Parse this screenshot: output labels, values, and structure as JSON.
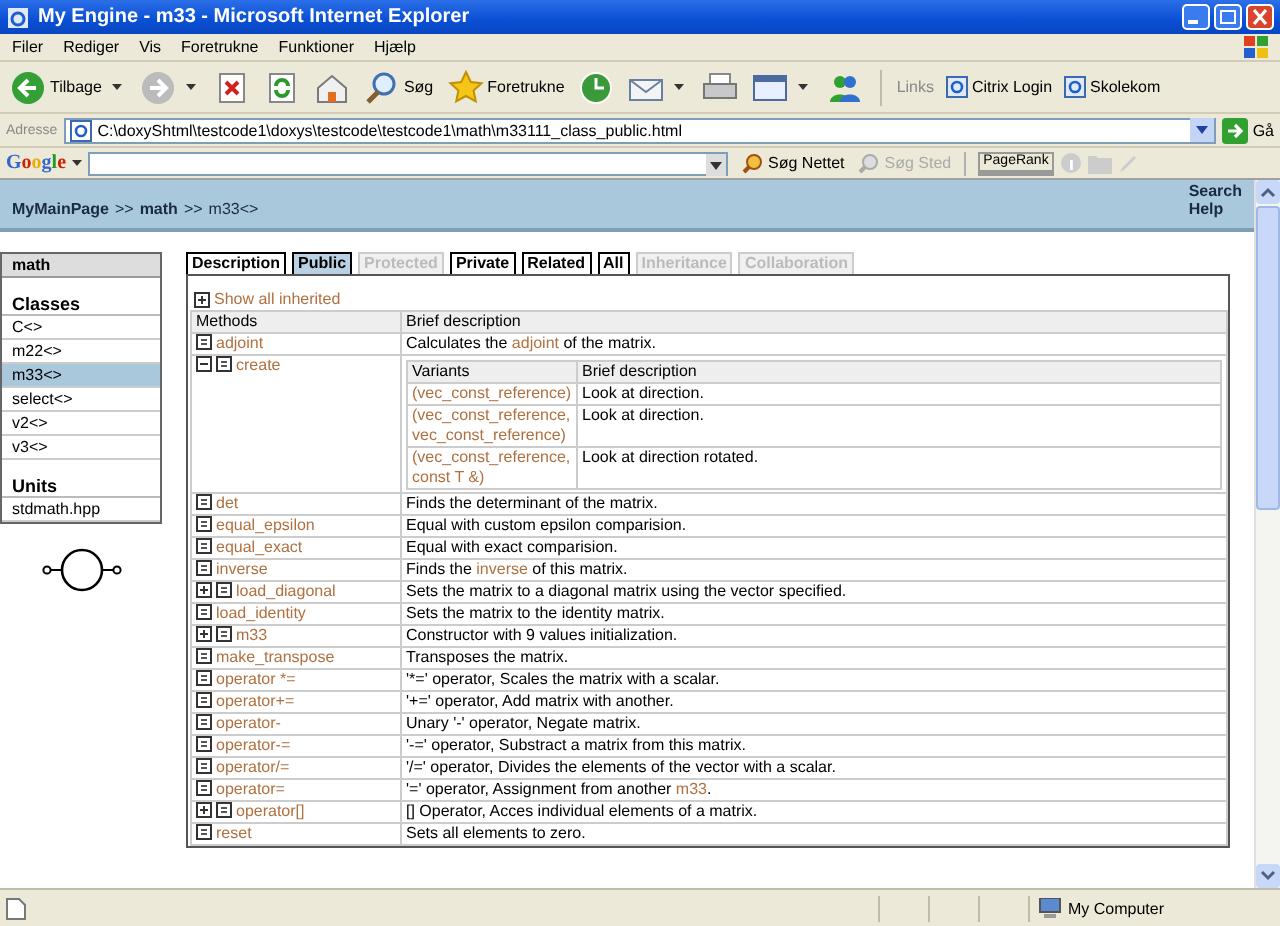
{
  "window": {
    "title": "My Engine - m33 - Microsoft Internet Explorer"
  },
  "menu": [
    "Filer",
    "Rediger",
    "Vis",
    "Foretrukne",
    "Funktioner",
    "Hjælp"
  ],
  "toolbar": [
    {
      "kind": "back",
      "label": "Tilbage",
      "menu": true
    },
    {
      "kind": "forward",
      "menu": true
    },
    {
      "kind": "stop"
    },
    {
      "kind": "refresh"
    },
    {
      "kind": "home"
    },
    {
      "kind": "search",
      "label": "Søg"
    },
    {
      "kind": "favorites",
      "label": "Foretrukne"
    },
    {
      "kind": "history"
    },
    {
      "kind": "mail",
      "menu": true
    },
    {
      "kind": "print"
    },
    {
      "kind": "edit",
      "menu": true
    },
    {
      "kind": "messenger"
    }
  ],
  "links": {
    "label": "Links",
    "items": [
      "Citrix Login",
      "Skolekom"
    ]
  },
  "address": {
    "label": "Adresse",
    "value": "C:\\doxyShtml\\testcode1\\doxys\\testcode\\testcode1\\math\\m33111_class_public.html",
    "go": "Gå"
  },
  "google": {
    "logo": "Google",
    "buttons": [
      {
        "label": "Søg Nettet",
        "disabled": false
      },
      {
        "label": "Søg Sted",
        "disabled": true
      }
    ],
    "pagerank": "PageRank"
  },
  "header": {
    "breadcrumb": [
      "MyMainPage",
      "math",
      "m33<>"
    ],
    "separator": ">>",
    "links": [
      "Search",
      "Help"
    ]
  },
  "sidebar": {
    "title": "math",
    "sections": [
      {
        "heading": "Classes",
        "items": [
          {
            "label": "C<>",
            "selected": false
          },
          {
            "label": "m22<>",
            "selected": false
          },
          {
            "label": "m33<>",
            "selected": true
          },
          {
            "label": "select<>",
            "selected": false
          },
          {
            "label": "v2<>",
            "selected": false
          },
          {
            "label": "v3<>",
            "selected": false
          }
        ]
      },
      {
        "heading": "Units",
        "items": [
          {
            "label": "stdmath.hpp",
            "selected": false
          }
        ]
      }
    ]
  },
  "tabs": [
    {
      "label": "Description",
      "selected": false,
      "disabled": false
    },
    {
      "label": "Public",
      "selected": true,
      "disabled": false
    },
    {
      "label": "Protected",
      "selected": false,
      "disabled": true
    },
    {
      "label": "Private",
      "selected": false,
      "disabled": false
    },
    {
      "label": "Related",
      "selected": false,
      "disabled": false
    },
    {
      "label": "All",
      "selected": false,
      "disabled": false
    },
    {
      "label": "Inheritance",
      "selected": false,
      "disabled": true
    },
    {
      "label": "Collaboration",
      "selected": false,
      "disabled": true
    }
  ],
  "show_inherited": "Show all inherited",
  "table": {
    "columns": [
      "Methods",
      "Brief description"
    ],
    "rows": [
      {
        "name": "adjoint",
        "icons": [
          {
            "kind": "item"
          }
        ],
        "description": [
          {
            "text": "Calculates the "
          },
          {
            "text": "adjoint",
            "link": true
          },
          {
            "text": " of the matrix."
          }
        ]
      },
      {
        "name": "create",
        "icons": [
          {
            "kind": "minus"
          },
          {
            "kind": "item"
          }
        ],
        "variants": {
          "columns": [
            "Variants",
            "Brief description"
          ],
          "rows": [
            {
              "args": "(vec_const_reference)",
              "description": "Look at direction."
            },
            {
              "args": "(vec_const_reference, vec_const_reference)",
              "description": "Look at direction."
            },
            {
              "args": "(vec_const_reference, const T &)",
              "description": "Look at direction rotated."
            }
          ]
        }
      },
      {
        "name": "det",
        "icons": [
          {
            "kind": "item"
          }
        ],
        "description": [
          {
            "text": "Finds the determinant of the matrix."
          }
        ]
      },
      {
        "name": "equal_epsilon",
        "icons": [
          {
            "kind": "item"
          }
        ],
        "description": [
          {
            "text": "Equal with custom epsilon comparision."
          }
        ]
      },
      {
        "name": "equal_exact",
        "icons": [
          {
            "kind": "item"
          }
        ],
        "description": [
          {
            "text": "Equal with exact comparision."
          }
        ]
      },
      {
        "name": "inverse",
        "icons": [
          {
            "kind": "item"
          }
        ],
        "description": [
          {
            "text": "Finds the "
          },
          {
            "text": "inverse",
            "link": true
          },
          {
            "text": " of this matrix."
          }
        ]
      },
      {
        "name": "load_diagonal",
        "icons": [
          {
            "kind": "plus"
          },
          {
            "kind": "item"
          }
        ],
        "description": [
          {
            "text": "Sets the matrix to a diagonal matrix using the vector specified."
          }
        ]
      },
      {
        "name": "load_identity",
        "icons": [
          {
            "kind": "item"
          }
        ],
        "description": [
          {
            "text": "Sets the matrix to the identity matrix."
          }
        ]
      },
      {
        "name": "m33",
        "icons": [
          {
            "kind": "plus"
          },
          {
            "kind": "item"
          }
        ],
        "description": [
          {
            "text": "Constructor with 9 values initialization."
          }
        ]
      },
      {
        "name": "make_transpose",
        "icons": [
          {
            "kind": "item"
          }
        ],
        "description": [
          {
            "text": "Transposes the matrix."
          }
        ]
      },
      {
        "name": "operator *=",
        "icons": [
          {
            "kind": "item"
          }
        ],
        "description": [
          {
            "text": "'*=' operator, Scales the matrix with a scalar."
          }
        ]
      },
      {
        "name": "operator+=",
        "icons": [
          {
            "kind": "item"
          }
        ],
        "description": [
          {
            "text": "'+=' operator, Add matrix with another."
          }
        ]
      },
      {
        "name": "operator-",
        "icons": [
          {
            "kind": "item"
          }
        ],
        "description": [
          {
            "text": "Unary '-' operator, Negate matrix."
          }
        ]
      },
      {
        "name": "operator-=",
        "icons": [
          {
            "kind": "item"
          }
        ],
        "description": [
          {
            "text": "'-=' operator, Substract a matrix from this matrix."
          }
        ]
      },
      {
        "name": "operator/=",
        "icons": [
          {
            "kind": "item"
          }
        ],
        "description": [
          {
            "text": "'/=' operator, Divides the elements of the vector with a scalar."
          }
        ]
      },
      {
        "name": "operator=",
        "icons": [
          {
            "kind": "item"
          }
        ],
        "description": [
          {
            "text": "'=' operator, Assignment from another "
          },
          {
            "text": "m33",
            "link": true
          },
          {
            "text": "."
          }
        ]
      },
      {
        "name": "operator[]",
        "icons": [
          {
            "kind": "plus"
          },
          {
            "kind": "item"
          }
        ],
        "description": [
          {
            "text": "[] Operator, Acces individual elements of a matrix."
          }
        ]
      },
      {
        "name": "reset",
        "icons": [
          {
            "kind": "item"
          }
        ],
        "description": [
          {
            "text": "Sets all elements to zero."
          }
        ]
      }
    ]
  },
  "status_bar": {
    "zone": "My Computer"
  }
}
